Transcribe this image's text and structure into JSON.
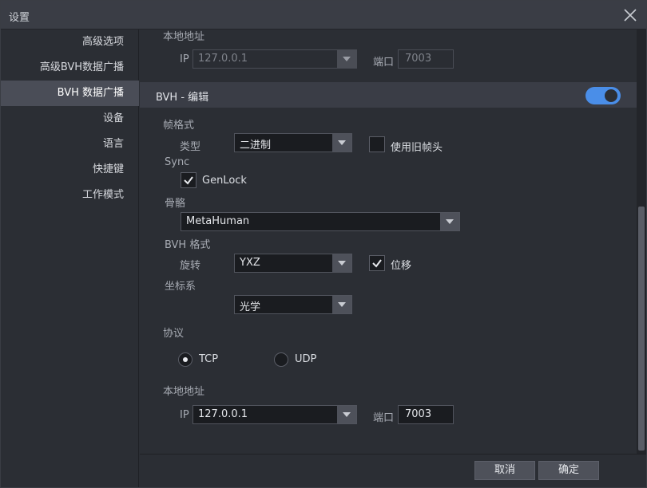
{
  "window": {
    "title": "设置"
  },
  "sidebar": {
    "items": [
      {
        "label": "高级选项"
      },
      {
        "label": "高级BVH数据广播"
      },
      {
        "label": "BVH 数据广播",
        "active": true
      },
      {
        "label": "设备"
      },
      {
        "label": "语言"
      },
      {
        "label": "快捷键"
      },
      {
        "label": "工作模式"
      }
    ]
  },
  "top_address": {
    "label": "本地地址",
    "ip_label": "IP",
    "ip_value": "127.0.0.1",
    "port_label": "端口",
    "port_value": "7003"
  },
  "bvh_edit": {
    "title": "BVH - 编辑",
    "enabled": true,
    "frame_format": {
      "label": "帧格式",
      "type_label": "类型",
      "type_value": "二进制",
      "legacy_header_label": "使用旧帧头",
      "legacy_header_checked": false
    },
    "sync": {
      "label": "Sync",
      "genlock_label": "GenLock",
      "genlock_checked": true
    },
    "skeleton": {
      "label": "骨骼",
      "value": "MetaHuman"
    },
    "bvh_format": {
      "label": "BVH 格式",
      "rotation_label": "旋转",
      "rotation_value": "YXZ",
      "displacement_label": "位移",
      "displacement_checked": true
    },
    "coordinate": {
      "label": "坐标系",
      "value": "光学"
    },
    "protocol": {
      "label": "协议",
      "options": [
        {
          "label": "TCP",
          "selected": true
        },
        {
          "label": "UDP",
          "selected": false
        }
      ]
    },
    "local_address": {
      "label": "本地地址",
      "ip_label": "IP",
      "ip_value": "127.0.0.1",
      "port_label": "端口",
      "port_value": "7003"
    }
  },
  "footer": {
    "cancel_label": "取消",
    "ok_label": "确定"
  },
  "colors": {
    "accent": "#4a8ee8",
    "window_bg": "#2b2e34",
    "active_nav": "#4a4d57"
  }
}
